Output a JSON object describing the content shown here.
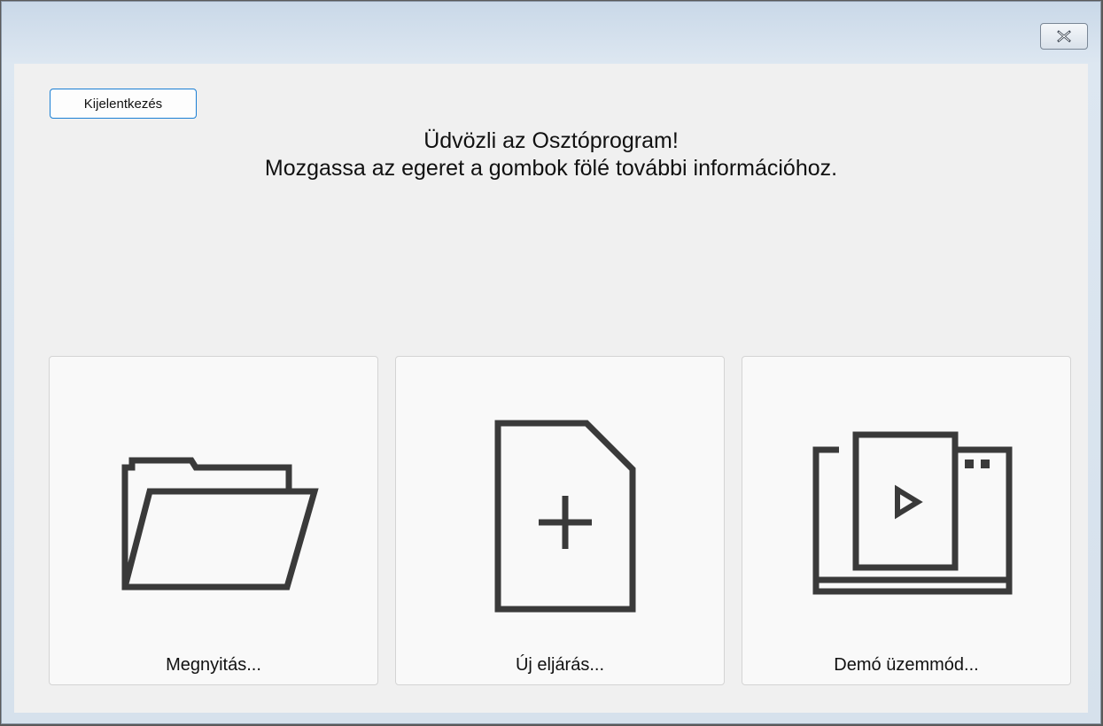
{
  "window": {
    "close_icon": "close-icon"
  },
  "logout_label": "Kijelentkezés",
  "welcome": {
    "line1": "Üdvözli az Osztóprogram!",
    "line2": "Mozgassa az egeret a gombok fölé további információhoz."
  },
  "tiles": [
    {
      "label": "Megnyitás...",
      "icon": "folder-open-icon"
    },
    {
      "label": "Új eljárás...",
      "icon": "new-document-icon"
    },
    {
      "label": "Demó üzemmód...",
      "icon": "demo-video-icon"
    }
  ],
  "colors": {
    "accent": "#1a7fd4",
    "icon_stroke": "#3a3a3a"
  }
}
